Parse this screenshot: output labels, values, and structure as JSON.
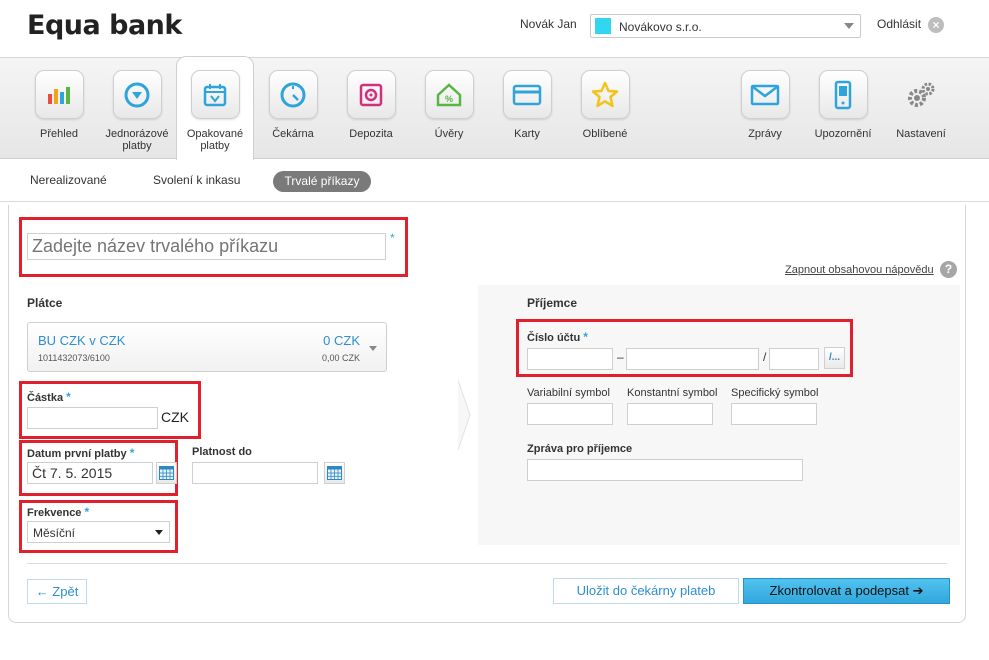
{
  "header": {
    "logo": "Equa bank",
    "user_name": "Novák Jan",
    "company": "Novákovo s.r.o.",
    "logout": "Odhlásit"
  },
  "nav": [
    {
      "label": "Přehled",
      "icon": "chart-icon",
      "color": "#e94e3c"
    },
    {
      "label": "Jednorázové platby",
      "icon": "download-circle-icon",
      "color": "#2fa4dc"
    },
    {
      "label": "Opakované platby",
      "icon": "calendar-icon",
      "color": "#2fa4dc",
      "active": true
    },
    {
      "label": "Čekárna",
      "icon": "gauge-icon",
      "color": "#2fa4dc"
    },
    {
      "label": "Depozita",
      "icon": "safe-icon",
      "color": "#d2307d"
    },
    {
      "label": "Úvěry",
      "icon": "house-percent-icon",
      "color": "#5ab545"
    },
    {
      "label": "Karty",
      "icon": "card-icon",
      "color": "#2fa4dc"
    },
    {
      "label": "Oblíbené",
      "icon": "star-icon",
      "color": "#f3c417"
    },
    {
      "label": "Zprávy",
      "icon": "envelope-icon",
      "color": "#2fa4dc"
    },
    {
      "label": "Upozornění",
      "icon": "phone-icon",
      "color": "#2fa4dc"
    },
    {
      "label": "Nastavení",
      "icon": "gears-icon",
      "color": "#888888"
    }
  ],
  "subtabs": {
    "unrealized": "Nerealizované",
    "direct_debit": "Svolení k inkasu",
    "standing_orders": "Trvalé příkazy"
  },
  "form": {
    "title_placeholder": "Zadejte název trvalého příkazu",
    "required_mark": "*",
    "help_link": "Zapnout obsahovou nápovědu",
    "help_icon": "?",
    "payer": {
      "section": "Plátce",
      "account_name": "BU CZK v CZK",
      "account_number": "1011432073/6100",
      "balance": "0 CZK",
      "available": "0,00 CZK"
    },
    "amount": {
      "label": "Částka",
      "currency": "CZK",
      "value": ""
    },
    "first_date": {
      "label": "Datum první platby",
      "value": "Čt 7. 5. 2015"
    },
    "valid_until": {
      "label": "Platnost do",
      "value": ""
    },
    "frequency": {
      "label": "Frekvence",
      "value": "Měsíční"
    },
    "payee": {
      "section": "Příjemce",
      "account_label": "Číslo účtu",
      "dash": "–",
      "slash": "/",
      "bank_button": "/...",
      "variable_symbol": "Variabilní symbol",
      "constant_symbol": "Konstantní symbol",
      "specific_symbol": "Specifický symbol",
      "message": "Zpráva pro příjemce"
    }
  },
  "buttons": {
    "back": "← Zpět",
    "save": "Uložit do čekárny plateb",
    "submit": "Zkontrolovat a podepsat ➔"
  }
}
